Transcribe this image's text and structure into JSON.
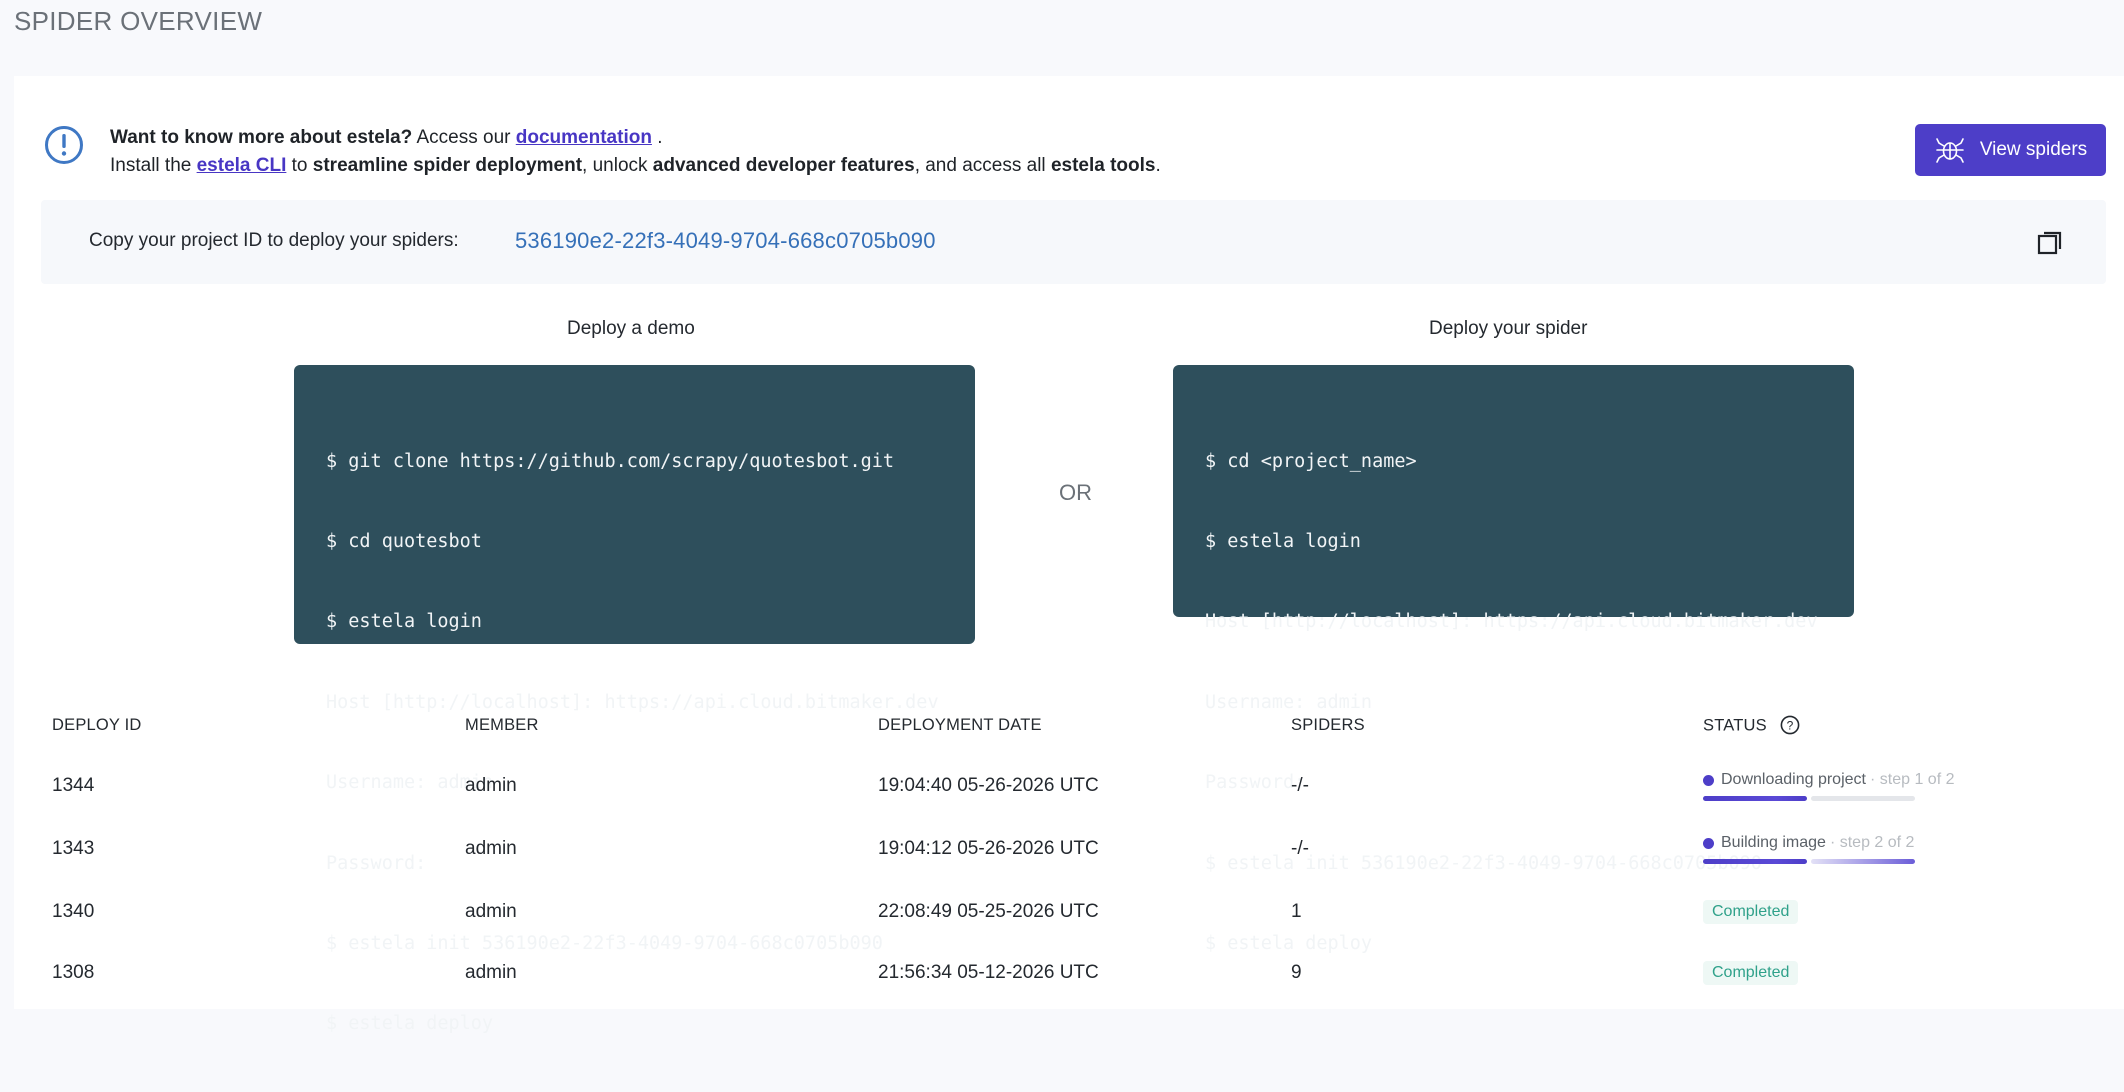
{
  "page": {
    "title": "SPIDER OVERVIEW"
  },
  "info": {
    "line1_bold": "Want to know more about estela?",
    "line1_text": " Access our ",
    "line1_link": "documentation",
    "line1_end": " .",
    "line2_a": "Install the ",
    "line2_link": "estela CLI",
    "line2_b": " to ",
    "line2_bold1": "streamline spider deployment",
    "line2_c": ", unlock ",
    "line2_bold2": "advanced developer features",
    "line2_d": ", and access all ",
    "line2_bold3": "estela tools",
    "line2_e": "."
  },
  "header_button": {
    "label": "View spiders",
    "icon": "spider-icon"
  },
  "project": {
    "label": "Copy your project ID to deploy your spiders:",
    "id": "536190e2-22f3-4049-9704-668c0705b090",
    "copy_icon": "copy-icon"
  },
  "deploy_demo": {
    "heading": "Deploy a demo",
    "lines": [
      "$ git clone https://github.com/scrapy/quotesbot.git",
      "$ cd quotesbot",
      "$ estela login",
      "Host [http://localhost]: https://api.cloud.bitmaker.dev",
      "Username: admin",
      "Password:",
      "$ estela init 536190e2-22f3-4049-9704-668c0705b090",
      "$ estela deploy"
    ]
  },
  "or_label": "OR",
  "deploy_spider": {
    "heading": "Deploy your spider",
    "lines": [
      "$ cd <project_name>",
      "$ estela login",
      "Host [http://localhost]: https://api.cloud.bitmaker.dev",
      "Username: admin",
      "Password:",
      "$ estela init 536190e2-22f3-4049-9704-668c0705b090",
      "$ estela deploy"
    ]
  },
  "table": {
    "columns": [
      "DEPLOY ID",
      "MEMBER",
      "DEPLOYMENT DATE",
      "SPIDERS",
      "STATUS"
    ],
    "rows": [
      {
        "id": "1344",
        "member": "admin",
        "date": "19:04:40 05-26-2026 UTC",
        "spiders": "-/-",
        "status": "Downloading project",
        "step": "· step 1 of 2",
        "progress_steps_done": 1,
        "progress_steps_total": 2
      },
      {
        "id": "1343",
        "member": "admin",
        "date": "19:04:12 05-26-2026 UTC",
        "spiders": "-/-",
        "status": "Building image",
        "step": "· step 2 of 2",
        "progress_steps_done": 2,
        "progress_steps_total": 2
      },
      {
        "id": "1340",
        "member": "admin",
        "date": "22:08:49 05-25-2026 UTC",
        "spiders": "1",
        "status": "Completed"
      },
      {
        "id": "1308",
        "member": "admin",
        "date": "21:56:34 05-12-2026 UTC",
        "spiders": "9",
        "status": "Completed"
      }
    ]
  },
  "colors": {
    "accent": "#4d3ec8",
    "code_bg": "#2e4f5c",
    "link": "#3570b8",
    "completed": "#2fa18a"
  }
}
